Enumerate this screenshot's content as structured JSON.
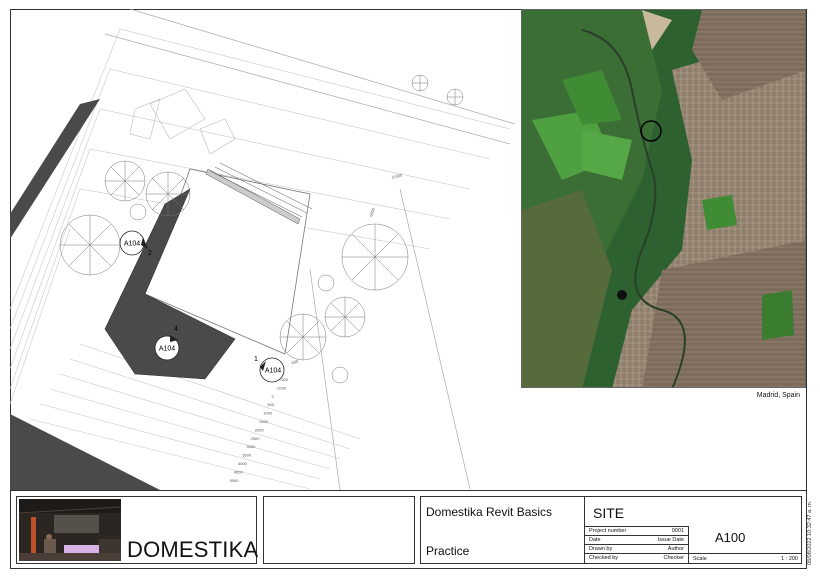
{
  "plan": {
    "tags": [
      {
        "ref": "A104",
        "num": "2"
      },
      {
        "ref": "A104",
        "num": "4"
      },
      {
        "ref": "A104",
        "num": "1"
      }
    ],
    "dims": {
      "right": "11000",
      "top": "6000",
      "mid": "-500",
      "stack": [
        "-500",
        "-1000",
        "0",
        "500",
        "1000",
        "1500",
        "2000",
        "2500",
        "3000",
        "3500",
        "4000",
        "4500",
        "5000"
      ]
    }
  },
  "map": {
    "caption": "Madrid, Spain"
  },
  "titleblock": {
    "logo_text": "DOMESTIKA",
    "project_name": "Domestika Revit Basics",
    "project_phase": "Practice",
    "sheet_name": "SITE",
    "sheet_number": "A100",
    "fields": {
      "project_number_label": "Project number",
      "project_number_value": "0001",
      "date_label": "Date",
      "date_value": "Issue Date",
      "drawn_by_label": "Drawn by",
      "drawn_by_value": "Author",
      "checked_by_label": "Checked by",
      "checked_by_value": "Checker",
      "scale_label": "Scale",
      "scale_value": "1 : 200"
    },
    "timestamp": "08/08/2022 10:32:47 a. m."
  },
  "colors": {
    "building_dark": "#4a4a4a",
    "line": "#9a9a9a",
    "map_green": "#2f6b2f",
    "map_urban": "#8a7a6a"
  }
}
